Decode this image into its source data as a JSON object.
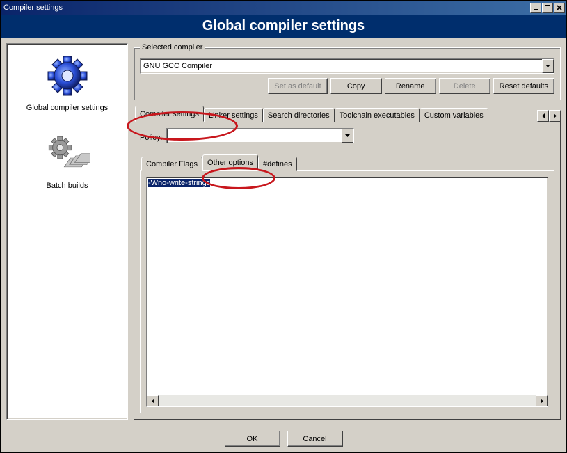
{
  "window": {
    "title": "Compiler settings"
  },
  "header": {
    "title": "Global compiler settings"
  },
  "sidebar": {
    "items": [
      {
        "label": "Global compiler settings"
      },
      {
        "label": "Batch builds"
      }
    ]
  },
  "selected_compiler": {
    "legend": "Selected compiler",
    "value": "GNU GCC Compiler",
    "buttons": {
      "set_default": "Set as default",
      "copy": "Copy",
      "rename": "Rename",
      "delete": "Delete",
      "reset": "Reset defaults"
    }
  },
  "tabs": {
    "items": [
      {
        "label": "Compiler settings",
        "active": true
      },
      {
        "label": "Linker settings"
      },
      {
        "label": "Search directories"
      },
      {
        "label": "Toolchain executables"
      },
      {
        "label": "Custom variables"
      }
    ]
  },
  "policy": {
    "label": "Policy:",
    "value": ""
  },
  "sub_tabs": {
    "items": [
      {
        "label": "Compiler Flags"
      },
      {
        "label": "Other options",
        "active": true
      },
      {
        "label": "#defines"
      }
    ]
  },
  "editor": {
    "content": "-Wno-write-strings"
  },
  "dialog": {
    "ok": "OK",
    "cancel": "Cancel"
  }
}
